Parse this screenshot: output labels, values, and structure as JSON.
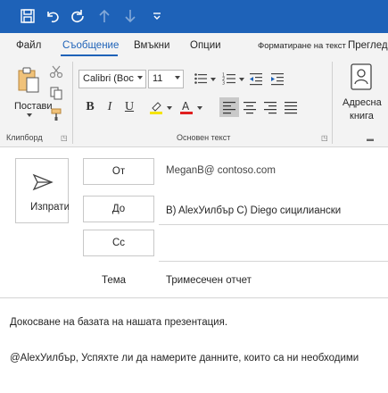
{
  "tabs": {
    "file": "Файл",
    "message": "Съобщение",
    "insert": "Вмъкни",
    "options": "Опции",
    "format_text": "Форматиране на текст",
    "review": "Преглед"
  },
  "ribbon": {
    "paste_label": "Постави",
    "clipboard_label": "Клипборд",
    "font_name": "Calibri (Boc",
    "font_size": "11",
    "basic_text_label": "Основен текст",
    "address_book_line1": "Адресна",
    "address_book_line2": "книга",
    "bold": "B",
    "italic": "I",
    "underline": "U",
    "highlight_color": "#f5e400",
    "font_color": "#e02020"
  },
  "compose": {
    "send_label": "Изпрати",
    "from_label": "От",
    "from_value": "MeganB@ contoso.com",
    "to_label": "До",
    "to_value": "B) AlexУилбър C) Diego сицилиански",
    "cc_label": "Cc",
    "subject_label": "Тема",
    "subject_value": "Тримесечен отчет"
  },
  "body": {
    "line1": "Докосване на базата на нашата презентация.",
    "line2": "@AlexУилбър, Успяхте ли да намерите данните, които са ни необходими"
  },
  "colors": {
    "accent": "#1e62b8"
  }
}
